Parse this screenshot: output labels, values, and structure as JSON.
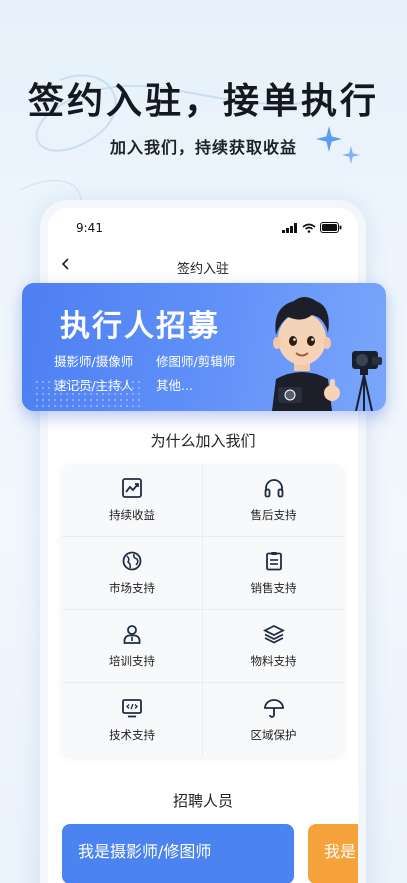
{
  "hero": {
    "title": "签约入驻，接单执行",
    "subtitle": "加入我们，持续获取收益"
  },
  "status_bar": {
    "time": "9:41"
  },
  "nav": {
    "back_icon": "chevron-left-icon",
    "title": "签约入驻"
  },
  "banner": {
    "title": "执行人招募",
    "roles": [
      "摄影师/摄像师",
      "修图师/剪辑师",
      "速记员/主持人",
      "其他..."
    ]
  },
  "why_join": {
    "title": "为什么加入我们",
    "items": [
      {
        "label": "持续收益",
        "icon": "trend-chart-icon"
      },
      {
        "label": "售后支持",
        "icon": "headphones-icon"
      },
      {
        "label": "市场支持",
        "icon": "globe-icon"
      },
      {
        "label": "销售支持",
        "icon": "clipboard-icon"
      },
      {
        "label": "培训支持",
        "icon": "trainer-icon"
      },
      {
        "label": "物料支持",
        "icon": "layers-icon"
      },
      {
        "label": "技术支持",
        "icon": "code-monitor-icon"
      },
      {
        "label": "区域保护",
        "icon": "umbrella-icon"
      }
    ]
  },
  "recruit": {
    "title": "招聘人员",
    "cards": [
      {
        "label": "我是摄影师/修图师",
        "color": "#4b84f0"
      },
      {
        "label": "我是",
        "color": "#f6a23a"
      }
    ]
  },
  "colors": {
    "accent": "#4d7ff2",
    "icon": "#1f2a44"
  }
}
